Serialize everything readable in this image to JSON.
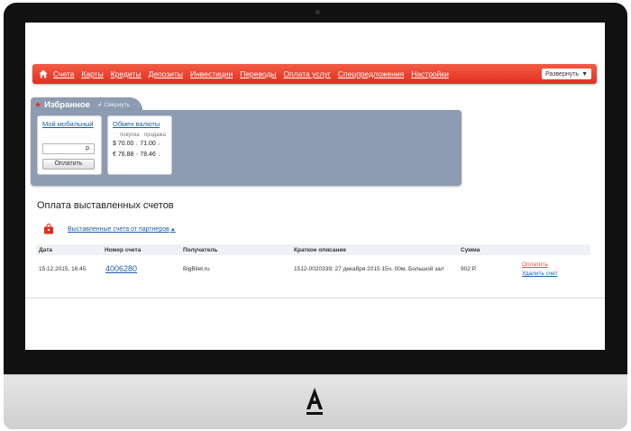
{
  "nav": {
    "items": [
      "Счета",
      "Карты",
      "Кредиты",
      "Депозиты",
      "Инвестиции",
      "Переводы",
      "Оплата услуг",
      "Спецпредложения",
      "Настройки"
    ],
    "expand_label": "Развернуть"
  },
  "favorites": {
    "title": "Избранное",
    "collapse_label": "Свернуть",
    "mobile": {
      "title": "Мой мобильный",
      "currency": "р.",
      "pay_label": "Оплатить"
    },
    "exchange": {
      "title": "Обмен валюты",
      "buy_label": "покупка",
      "sell_label": "продажа",
      "rows": [
        {
          "symbol": "$",
          "buy": "70.00",
          "sell": "71.00",
          "buy_trend": "down",
          "sell_trend": "down"
        },
        {
          "symbol": "€",
          "buy": "76.88",
          "sell": "78.46",
          "buy_trend": "up",
          "sell_trend": "down"
        }
      ]
    }
  },
  "bills": {
    "title": "Оплата выставленных счетов",
    "partners_link": "Выставленные счета от партнеров",
    "columns": [
      "Дата",
      "Номер счета",
      "Получатель",
      "Краткое описание",
      "Сумма"
    ],
    "rows": [
      {
        "date": "15.12.2015, 16:45",
        "number": "4006280",
        "recipient": "BigBilet.ru",
        "description": "1512-0020339; 27 декабря 2015 15ч. 00м, Большой зал",
        "amount": "902 Р.",
        "pay_action": "Оплатить",
        "delete_action": "Удалить счет"
      }
    ]
  },
  "colors": {
    "brand_red": "#e32f1f",
    "panel_blue_gray": "#8d9cb0",
    "link_blue": "#1f5fa6"
  },
  "icons": [
    "home-icon",
    "star-icon",
    "collapse-icon",
    "bag-icon",
    "alfa-logo"
  ]
}
